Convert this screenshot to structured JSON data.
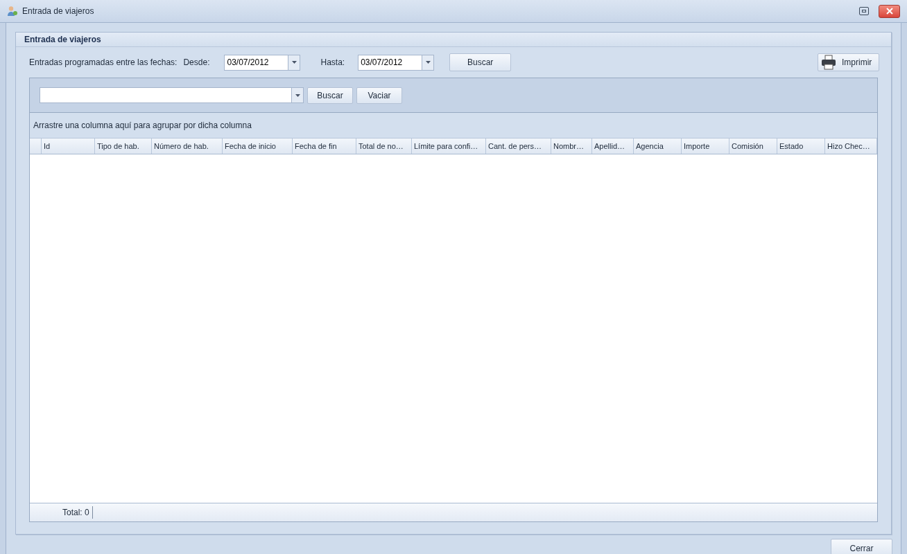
{
  "window": {
    "title": "Entrada de viajeros"
  },
  "group": {
    "title": "Entrada de viajeros"
  },
  "filter": {
    "label": "Entradas programadas entre las fechas:",
    "from_label": "Desde:",
    "from_value": "03/07/2012",
    "to_label": "Hasta:",
    "to_value": "03/07/2012",
    "search_button": "Buscar",
    "print_button": "Imprimir"
  },
  "find_panel": {
    "search_button": "Buscar",
    "clear_button": "Vaciar"
  },
  "group_panel_hint": "Arrastre una columna aquí para agrupar por dicha columna",
  "table": {
    "columns": [
      {
        "label": "Id"
      },
      {
        "label": "Tipo de hab."
      },
      {
        "label": "Número de hab."
      },
      {
        "label": "Fecha de inicio"
      },
      {
        "label": "Fecha de fin"
      },
      {
        "label": "Total de no…"
      },
      {
        "label": "Límite para confi…"
      },
      {
        "label": "Cant. de pers…"
      },
      {
        "label": "Nombr…"
      },
      {
        "label": "Apellid…"
      },
      {
        "label": "Agencia"
      },
      {
        "label": "Importe"
      },
      {
        "label": "Comisión"
      },
      {
        "label": "Estado"
      },
      {
        "label": "Hizo Chec…"
      }
    ],
    "footer": "Total: 0"
  },
  "buttons": {
    "close": "Cerrar"
  }
}
